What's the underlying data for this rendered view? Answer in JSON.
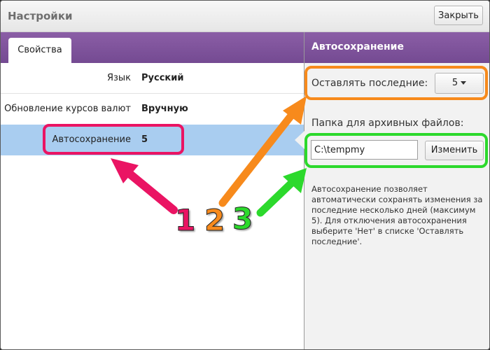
{
  "window": {
    "title": "Настройки",
    "close_label": "Закрыть"
  },
  "tabs": [
    {
      "label": "Свойства",
      "active": true
    }
  ],
  "settings": [
    {
      "label": "Язык",
      "value": "Русский"
    },
    {
      "label": "Обновление курсов валют",
      "value": "Вручную"
    },
    {
      "label": "Автосохранение",
      "value": "5",
      "selected": true
    }
  ],
  "panel": {
    "title": "Автосохранение",
    "keep_label": "Оставлять последние:",
    "keep_value": "5",
    "folder_label": "Папка для архивных файлов:",
    "folder_value": "C:\\tempmy",
    "change_label": "Изменить",
    "description": "Автосохранение позволяет автоматически сохранять изменения за последние несколько дней (максимум 5). Для отключения автосохранения выберите 'Нет' в списке 'Оставлять последние'."
  },
  "annotations": [
    {
      "number": "1",
      "color": "#ea1463"
    },
    {
      "number": "2",
      "color": "#f78a1c"
    },
    {
      "number": "3",
      "color": "#2cd92c"
    }
  ],
  "colors": {
    "accent": "#7b4f98",
    "selection": "#a9cdf0"
  }
}
